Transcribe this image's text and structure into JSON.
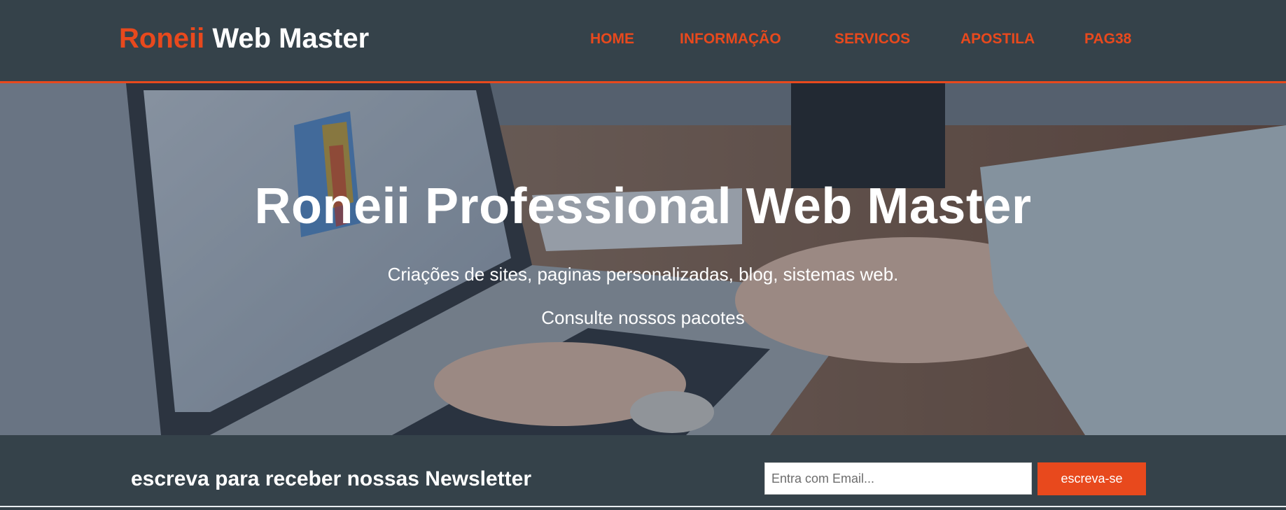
{
  "header": {
    "logo_highlight": "Roneii",
    "logo_rest": "Web Master",
    "nav": [
      "HOME",
      "INFORMAÇÃO",
      "SERVICOS",
      "APOSTILA",
      "PAG38"
    ]
  },
  "showcase": {
    "title": "Roneii Professional Web Master",
    "subtitle": "Criações de sites, paginas personalizadas, blog, sistemas web.",
    "subtitle2": "Consulte nossos pacotes"
  },
  "newsletter": {
    "heading": "escreva para receber nossas Newsletter",
    "email_placeholder": "Entra com Email...",
    "email_value": "",
    "button_label": "escreva-se"
  },
  "colors": {
    "accent": "#e8491d",
    "header_bg": "#35424a",
    "text_light": "#ffffff"
  }
}
